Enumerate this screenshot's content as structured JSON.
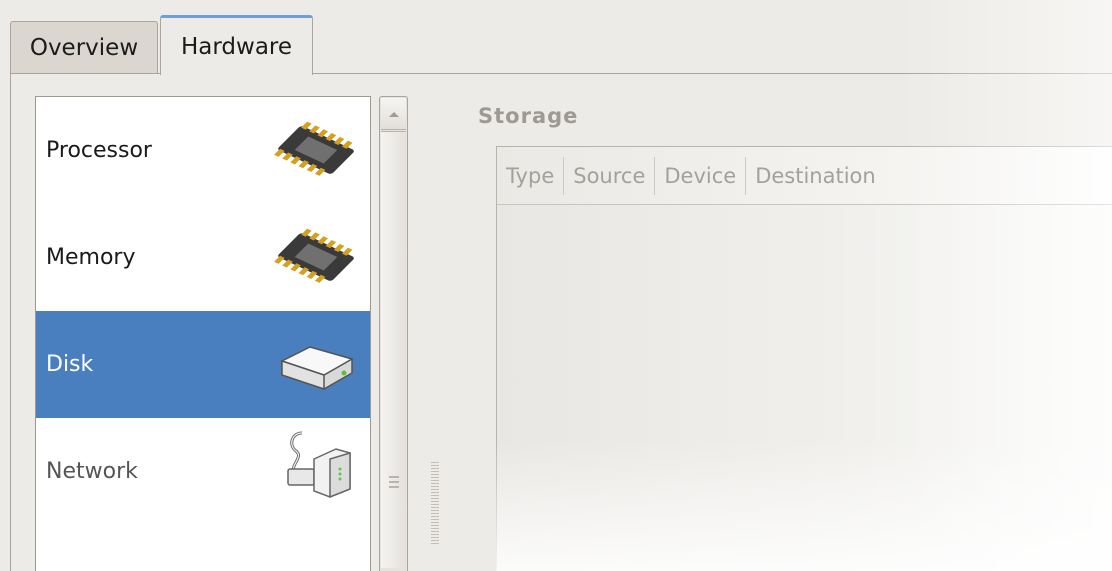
{
  "tabs": [
    {
      "label": "Overview",
      "selected": false
    },
    {
      "label": "Hardware",
      "selected": true
    }
  ],
  "hardware_list": [
    {
      "label": "Processor",
      "icon": "chip-icon",
      "selected": false
    },
    {
      "label": "Memory",
      "icon": "memory-chip-icon",
      "selected": false
    },
    {
      "label": "Disk",
      "icon": "disk-drive-icon",
      "selected": true
    },
    {
      "label": "Network",
      "icon": "network-adapter-icon",
      "selected": false
    }
  ],
  "storage": {
    "title": "Storage",
    "columns": [
      "Type",
      "Source",
      "Device",
      "Destination"
    ]
  },
  "colors": {
    "selection": "#4a7fbf",
    "tab_accent": "#6ea0d8",
    "window_bg": "#edebe7"
  }
}
